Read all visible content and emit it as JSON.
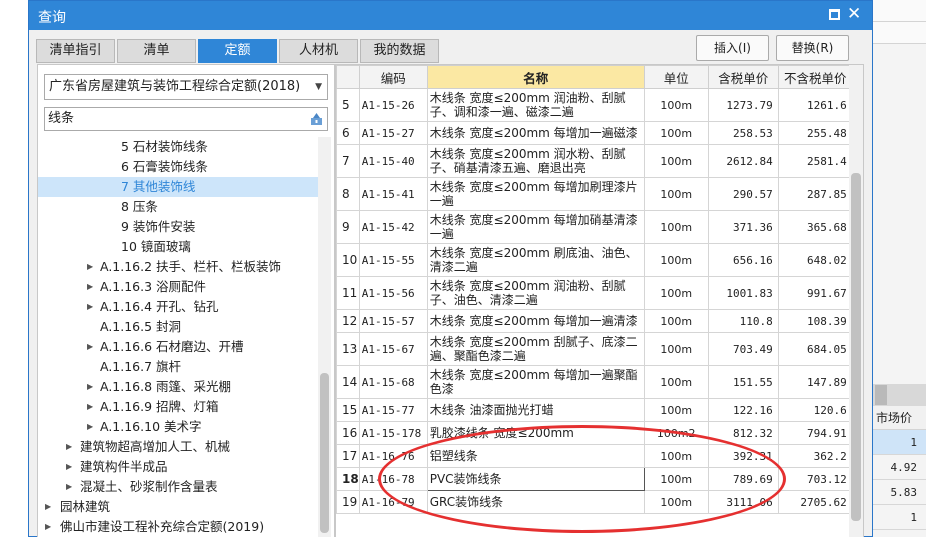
{
  "window": {
    "title": "查询"
  },
  "tabs": [
    {
      "label": "清单指引"
    },
    {
      "label": "清单"
    },
    {
      "label": "定额",
      "active": true
    },
    {
      "label": "人材机"
    },
    {
      "label": "我的数据"
    }
  ],
  "actions": {
    "insert_label": "插入(I)",
    "replace_label": "替换(R)"
  },
  "library": {
    "selected": "广东省房屋建筑与装饰工程综合定额(2018)"
  },
  "search": {
    "value": "线条"
  },
  "tree": [
    {
      "label": "5 石材装饰线条"
    },
    {
      "label": "6 石膏装饰线条"
    },
    {
      "label": "7 其他装饰线",
      "selected": true
    },
    {
      "label": "8 压条"
    },
    {
      "label": "9 装饰件安装"
    },
    {
      "label": "10 镜面玻璃"
    },
    {
      "label": "A.1.16.2 扶手、栏杆、栏板装饰"
    },
    {
      "label": "A.1.16.3 浴厕配件"
    },
    {
      "label": "A.1.16.4 开孔、钻孔"
    },
    {
      "label": "A.1.16.5 封洞"
    },
    {
      "label": "A.1.16.6 石材磨边、开槽"
    },
    {
      "label": "A.1.16.7 旗杆"
    },
    {
      "label": "A.1.16.8 雨篷、采光棚"
    },
    {
      "label": "A.1.16.9 招牌、灯箱"
    },
    {
      "label": "A.1.16.10 美术字"
    },
    {
      "label": "建筑物超高增加人工、机械"
    },
    {
      "label": "建筑构件半成品"
    },
    {
      "label": "混凝土、砂浆制作含量表"
    },
    {
      "label": "园林建筑"
    },
    {
      "label": "佛山市建设工程补充综合定额(2019)"
    }
  ],
  "table": {
    "headers": [
      "",
      "编码",
      "名称",
      "单位",
      "含税单价",
      "不含税单价"
    ],
    "rows": [
      {
        "idx": "5",
        "code": "A1-15-26",
        "name": "木线条 宽度≤200mm 润油粉、刮腻子、调和漆一遍、磁漆二遍",
        "unit": "100m",
        "price_tax": "1273.79",
        "price_notax": "1261.6"
      },
      {
        "idx": "6",
        "code": "A1-15-27",
        "name": "木线条 宽度≤200mm 每增加一遍磁漆",
        "unit": "100m",
        "price_tax": "258.53",
        "price_notax": "255.48"
      },
      {
        "idx": "7",
        "code": "A1-15-40",
        "name": "木线条 宽度≤200mm 润水粉、刮腻子、硝基清漆五遍、磨退出亮",
        "unit": "100m",
        "price_tax": "2612.84",
        "price_notax": "2581.4"
      },
      {
        "idx": "8",
        "code": "A1-15-41",
        "name": "木线条 宽度≤200mm 每增加刷理漆片一遍",
        "unit": "100m",
        "price_tax": "290.57",
        "price_notax": "287.85"
      },
      {
        "idx": "9",
        "code": "A1-15-42",
        "name": "木线条 宽度≤200mm 每增加硝基清漆一遍",
        "unit": "100m",
        "price_tax": "371.36",
        "price_notax": "365.68"
      },
      {
        "idx": "10",
        "code": "A1-15-55",
        "name": "木线条 宽度≤200mm 刷底油、油色、清漆二遍",
        "unit": "100m",
        "price_tax": "656.16",
        "price_notax": "648.02"
      },
      {
        "idx": "11",
        "code": "A1-15-56",
        "name": "木线条 宽度≤200mm 润油粉、刮腻子、油色、清漆二遍",
        "unit": "100m",
        "price_tax": "1001.83",
        "price_notax": "991.67"
      },
      {
        "idx": "12",
        "code": "A1-15-57",
        "name": "木线条 宽度≤200mm 每增加一遍清漆",
        "unit": "100m",
        "price_tax": "110.8",
        "price_notax": "108.39"
      },
      {
        "idx": "13",
        "code": "A1-15-67",
        "name": "木线条 宽度≤200mm 刮腻子、底漆二遍、聚酯色漆二遍",
        "unit": "100m",
        "price_tax": "703.49",
        "price_notax": "684.05"
      },
      {
        "idx": "14",
        "code": "A1-15-68",
        "name": "木线条 宽度≤200mm 每增加一遍聚酯色漆",
        "unit": "100m",
        "price_tax": "151.55",
        "price_notax": "147.89"
      },
      {
        "idx": "15",
        "code": "A1-15-77",
        "name": "木线条 油漆面抛光打蜡",
        "unit": "100m",
        "price_tax": "122.16",
        "price_notax": "120.6"
      },
      {
        "idx": "16",
        "code": "A1-15-178",
        "name": "乳胶漆线条 宽度≤200mm",
        "unit": "100m2",
        "price_tax": "812.32",
        "price_notax": "794.91"
      },
      {
        "idx": "17",
        "code": "A1-16-76",
        "name": "铝塑线条",
        "unit": "100m",
        "price_tax": "392.31",
        "price_notax": "362.2"
      },
      {
        "idx": "18",
        "code": "A1-16-78",
        "name": "PVC装饰线条",
        "unit": "100m",
        "price_tax": "789.69",
        "price_notax": "703.12",
        "current": true
      },
      {
        "idx": "19",
        "code": "A1-16-79",
        "name": "GRC装饰线条",
        "unit": "100m",
        "price_tax": "3111.06",
        "price_notax": "2705.62"
      }
    ]
  },
  "background": {
    "column_header": "市场价",
    "values": [
      "1",
      "4.92",
      "5.83",
      "1"
    ]
  },
  "colors": {
    "accent": "#2f86d7",
    "header_highlight": "#fbe8a3",
    "annotation": "#e53030"
  }
}
